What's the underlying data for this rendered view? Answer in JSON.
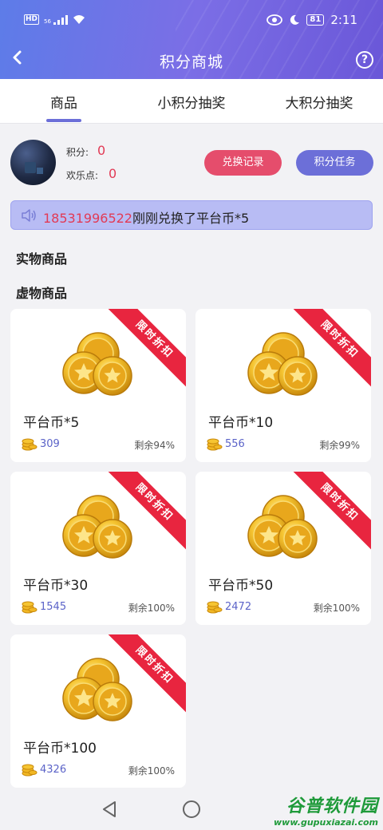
{
  "status_bar": {
    "network": "HD",
    "signal": "56",
    "battery": "81",
    "time": "2:11"
  },
  "nav": {
    "title": "积分商城",
    "help": "?"
  },
  "tabs": [
    {
      "label": "商品",
      "active": true
    },
    {
      "label": "小积分抽奖",
      "active": false
    },
    {
      "label": "大积分抽奖",
      "active": false
    }
  ],
  "user": {
    "points_label": "积分:",
    "points_value": "0",
    "fun_label": "欢乐点:",
    "fun_value": "0"
  },
  "buttons": {
    "history": "兑换记录",
    "tasks": "积分任务"
  },
  "marquee": {
    "phone": "18531996522",
    "text": "刚刚兑换了平台币*5"
  },
  "sections": {
    "physical": "实物商品",
    "virtual": "虚物商品"
  },
  "products": [
    {
      "name": "平台币*5",
      "price": "309",
      "stock": "剩余94%",
      "badge": "限时折扣"
    },
    {
      "name": "平台币*10",
      "price": "556",
      "stock": "剩余99%",
      "badge": "限时折扣"
    },
    {
      "name": "平台币*30",
      "price": "1545",
      "stock": "剩余100%",
      "badge": "限时折扣"
    },
    {
      "name": "平台币*50",
      "price": "2472",
      "stock": "剩余100%",
      "badge": "限时折扣"
    },
    {
      "name": "平台币*100",
      "price": "4326",
      "stock": "剩余100%",
      "badge": "限时折扣"
    }
  ],
  "watermark": {
    "main": "谷普软件园",
    "url": "www.gupuxiazai.com"
  },
  "colors": {
    "accent": "#6c6fd8",
    "pink": "#e54d6c",
    "red": "#e23a55",
    "ribbon": "#e8253f"
  }
}
